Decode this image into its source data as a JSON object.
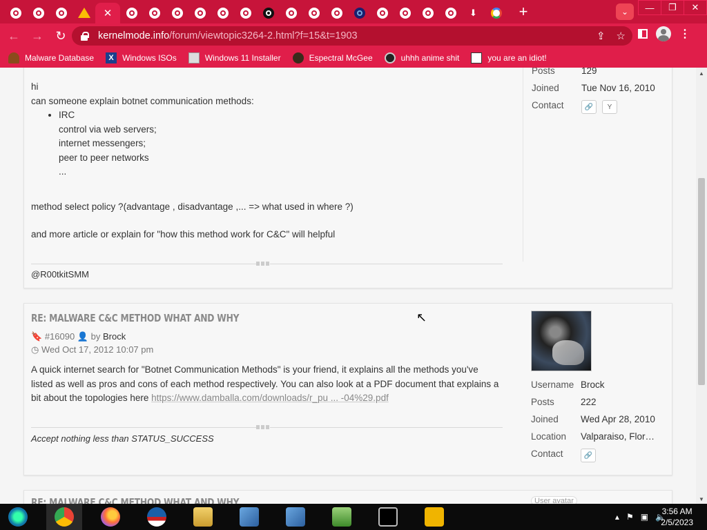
{
  "browser": {
    "url_domain": "kernelmode.info",
    "url_path": "/forum/viewtopic3264-2.html?f=15&t=1903",
    "tab_close_glyph": "✕",
    "new_tab_glyph": "+",
    "tab_icons": [
      "opera-icon",
      "opera-icon",
      "opera-icon",
      "drive-icon",
      "close-icon",
      "opera-icon",
      "opera-icon",
      "opera-icon",
      "opera-icon",
      "opera-icon",
      "opera-icon",
      "github-icon",
      "opera-icon",
      "opera-icon",
      "opera-icon",
      "gear-icon",
      "opera-icon",
      "opera-icon",
      "opera-icon",
      "opera-icon",
      "download-icon",
      "google-icon"
    ],
    "window_controls": [
      "—",
      "❐",
      "✕"
    ],
    "bookmarks": [
      {
        "label": "Malware Database",
        "icon": "poop-icon"
      },
      {
        "label": "Windows ISOs",
        "icon": "x-icon"
      },
      {
        "label": "Windows 11 Installer",
        "icon": "installer-icon"
      },
      {
        "label": "Espectral McGee",
        "icon": "avatar-icon"
      },
      {
        "label": "uhhh anime shit",
        "icon": "anime-icon"
      },
      {
        "label": "you are an idiot!",
        "icon": "smiley-icon"
      }
    ]
  },
  "post1": {
    "profile": {
      "posts_label": "Posts",
      "posts_value": "129",
      "joined_label": "Joined",
      "joined_value": "Tue Nov 16, 2010",
      "contact_label": "Contact",
      "contact_website": "🔗",
      "contact_y": "Y"
    },
    "body": {
      "greeting": "hi",
      "intro": "can someone explain botnet communication methods:",
      "list_bullet": "IRC",
      "list_lines": [
        "control via web servers;",
        "internet messengers;",
        "peer to peer networks",
        "..."
      ],
      "policy": "method select policy ?(advantage , disadvantage ,... => what used in where ?)",
      "request": "and more article or explain for \"how this method work for C&C\" will helpful"
    },
    "signature": "@R00tkitSMM"
  },
  "post2": {
    "title": "Re: Malware C&C method what and why",
    "post_id": "#16090",
    "by": "by",
    "author": "Brock",
    "date": "Wed Oct 17, 2012 10:07 pm",
    "body_text": "A quick internet search for \"Botnet Communication Methods\" is your friend, it explains all the methods you've listed as well as pros and cons of each method respectively. You can also look at a PDF document that explains a bit about the topologies here ",
    "body_link": "https://www.damballa.com/downloads/r_pu ... -04%29.pdf",
    "signature": "Accept nothing less than STATUS_SUCCESS",
    "profile": {
      "username_label": "Username",
      "username_value": "Brock",
      "posts_label": "Posts",
      "posts_value": "222",
      "joined_label": "Joined",
      "joined_value": "Wed Apr 28, 2010",
      "location_label": "Location",
      "location_value": "Valparaiso, Florida",
      "contact_label": "Contact",
      "contact_website": "🔗"
    }
  },
  "post3": {
    "title_partial": "Re: Malware C&C method what and why",
    "avatar_alt": "User avatar"
  },
  "taskbar": {
    "apps": [
      "windows-media-center-icon",
      "chrome-icon",
      "firefox-icon",
      "obama-logo-icon",
      "file-explorer-icon",
      "installer-icon",
      "installer-icon",
      "notepad-icon",
      "cmd-icon",
      "de-icon"
    ],
    "time": "3:56 AM",
    "date": "2/5/2023"
  }
}
